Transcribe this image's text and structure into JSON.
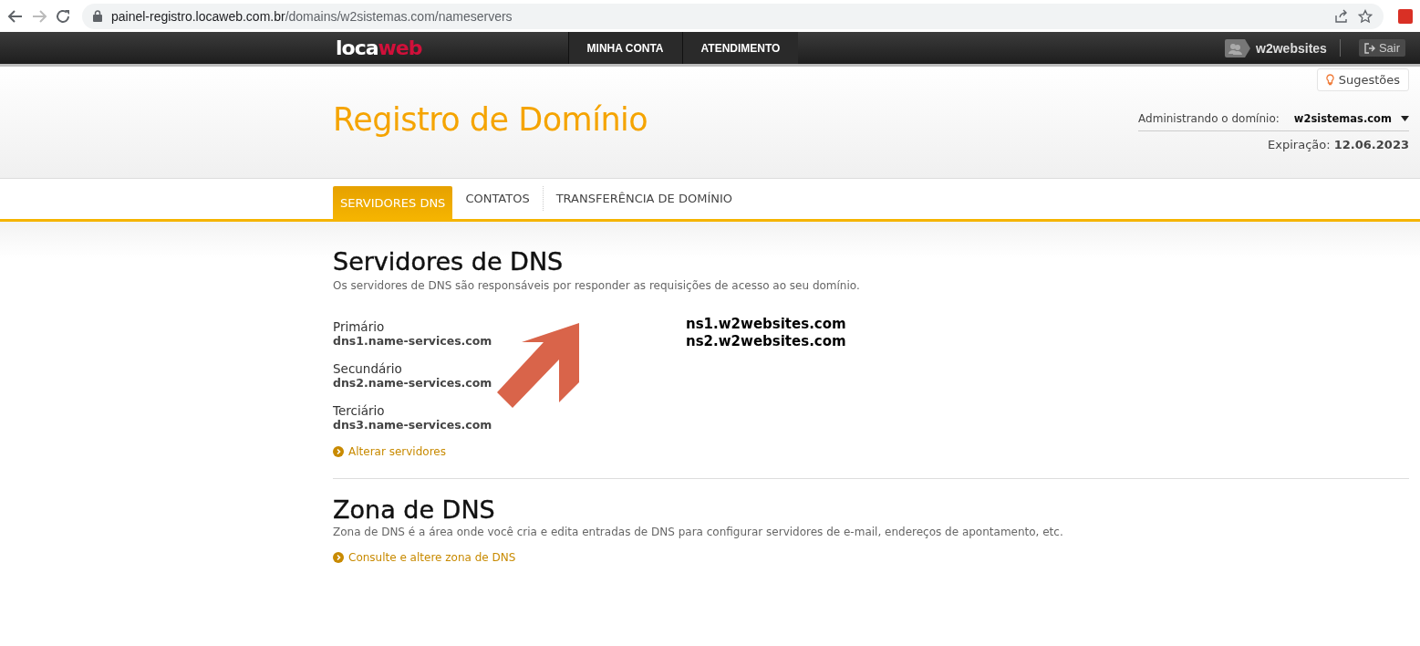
{
  "browser": {
    "url_host": "painel-registro.locaweb.com.br",
    "url_path": "/domains/w2sistemas.com/nameservers"
  },
  "nav": {
    "logo": [
      "loca",
      "web"
    ],
    "menu": [
      {
        "label": "MINHA CONTA"
      },
      {
        "label": "ATENDIMENTO"
      }
    ],
    "user": "w2websites",
    "logout": "Sair"
  },
  "header": {
    "suggestions": "Sugestões",
    "title": "Registro de Domínio",
    "domain_label": "Administrando o domínio:",
    "domain": "w2sistemas.com",
    "expiry_label": "Expiração:",
    "expiry": "12.06.2023"
  },
  "tabs": [
    {
      "label": "SERVIDORES DNS",
      "selected": true
    },
    {
      "label": "CONTATOS",
      "selected": false
    },
    {
      "label": "TRANSFERÊNCIA DE DOMÍNIO",
      "selected": false
    }
  ],
  "dns": {
    "title": "Servidores de DNS",
    "description": "Os servidores de DNS são responsáveis por responder as requisições de acesso ao seu domínio.",
    "servers": [
      {
        "label": "Primário",
        "value": "dns1.name-services.com"
      },
      {
        "label": "Secundário",
        "value": "dns2.name-services.com"
      },
      {
        "label": "Terciário",
        "value": "dns3.name-services.com"
      }
    ],
    "link": "Alterar servidores",
    "annotation": [
      "ns1.w2websites.com",
      "ns2.w2websites.com"
    ]
  },
  "zone": {
    "title": "Zona de DNS",
    "description": "Zona de DNS é a área onde você cria e edita entradas de DNS para configurar servidores de e-mail, endereços de apontamento, etc.",
    "link": "Consulte e altere zona de DNS"
  }
}
